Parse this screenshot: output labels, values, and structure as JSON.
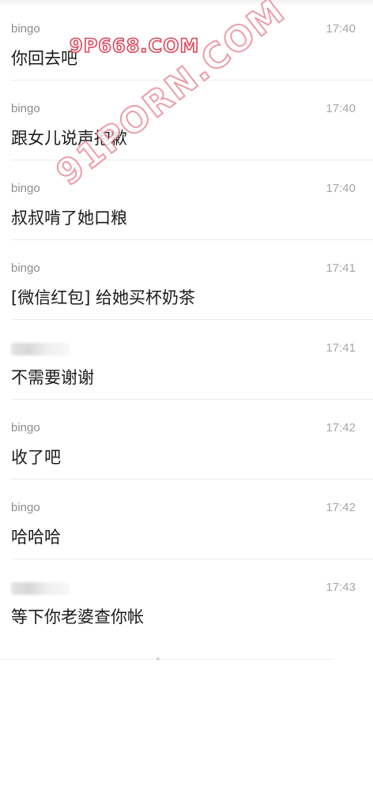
{
  "messages": [
    {
      "sender": "bingo",
      "time": "17:40",
      "text": "你回去吧"
    },
    {
      "sender": "bingo",
      "time": "17:40",
      "text": "跟女儿说声抱歉"
    },
    {
      "sender": "bingo",
      "time": "17:40",
      "text": "叔叔啃了她口粮"
    },
    {
      "sender": "bingo",
      "time": "17:41",
      "text": "[微信红包] 给她买杯奶茶"
    },
    {
      "sender": "",
      "time": "17:41",
      "text": "不需要谢谢"
    },
    {
      "sender": "bingo",
      "time": "17:42",
      "text": "收了吧"
    },
    {
      "sender": "bingo",
      "time": "17:42",
      "text": "哈哈哈"
    },
    {
      "sender": "",
      "time": "17:43",
      "text": "等下你老婆查你帐"
    }
  ],
  "watermarks": {
    "small": "9P668.COM",
    "large": "91PORN.COM"
  },
  "colors": {
    "watermark_stroke": "#e0475b",
    "sender": "#8c8c8c",
    "time": "#a6a6a6",
    "text": "#1a1a1a",
    "divider": "#ececec"
  }
}
